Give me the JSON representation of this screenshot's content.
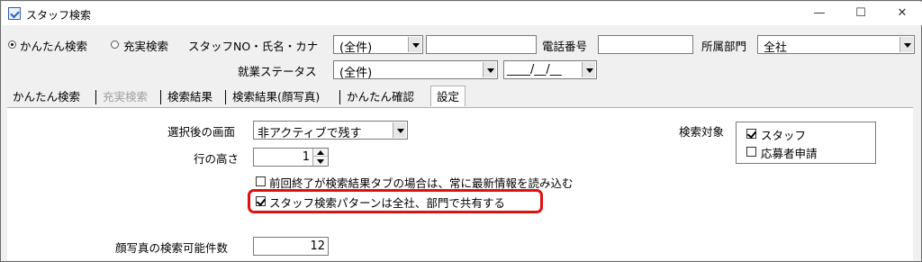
{
  "window": {
    "title": "スタッフ検索",
    "minimize": "—",
    "maximize": "☐",
    "close": "✕"
  },
  "search": {
    "radio_simple": "かんたん検索",
    "radio_full": "充実検索",
    "staff_label": "スタッフNO・氏名・カナ",
    "staff_scope": "(全件)",
    "phone_label": "電話番号",
    "dept_label": "所属部門",
    "dept_value": "全社",
    "status_label": "就業ステータス",
    "status_value": "(全件)",
    "date_value": "____/__/__"
  },
  "tabs": [
    {
      "label": "かんたん検索"
    },
    {
      "label": "充実検索"
    },
    {
      "label": "検索結果"
    },
    {
      "label": "検索結果(顔写真)"
    },
    {
      "label": "かんたん確認"
    },
    {
      "label": "設定"
    }
  ],
  "settings": {
    "after_select_label": "選択後の画面",
    "after_select_value": "非アクティブで残す",
    "row_height_label": "行の高さ",
    "row_height_value": "1",
    "refresh_label": "前回終了が検索結果タブの場合は、常に最新情報を読み込む",
    "refresh_checked": false,
    "share_label": "スタッフ検索パターンは全社、部門で共有する",
    "share_checked": true,
    "target_label": "検索対象",
    "target_staff": "スタッフ",
    "target_staff_checked": true,
    "target_applicant": "応募者申請",
    "target_applicant_checked": false,
    "photo_count_label": "顔写真の検索可能件数",
    "photo_count_value": "12"
  },
  "colors": {
    "highlight": "#e01010",
    "window_bg": "#f0f0f0",
    "panel_bg": "#ffffff"
  }
}
